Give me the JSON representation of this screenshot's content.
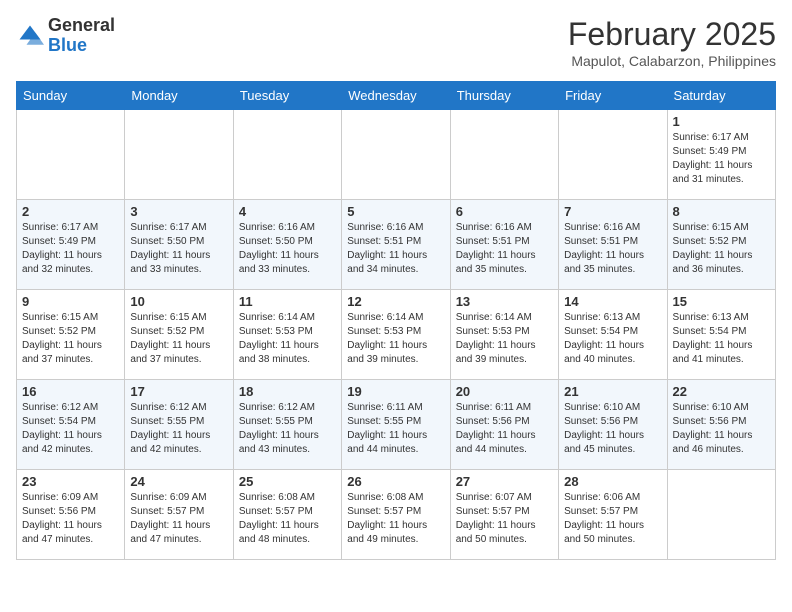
{
  "header": {
    "logo_general": "General",
    "logo_blue": "Blue",
    "month_year": "February 2025",
    "location": "Mapulot, Calabarzon, Philippines"
  },
  "weekdays": [
    "Sunday",
    "Monday",
    "Tuesday",
    "Wednesday",
    "Thursday",
    "Friday",
    "Saturday"
  ],
  "weeks": [
    [
      {
        "day": "",
        "info": ""
      },
      {
        "day": "",
        "info": ""
      },
      {
        "day": "",
        "info": ""
      },
      {
        "day": "",
        "info": ""
      },
      {
        "day": "",
        "info": ""
      },
      {
        "day": "",
        "info": ""
      },
      {
        "day": "1",
        "info": "Sunrise: 6:17 AM\nSunset: 5:49 PM\nDaylight: 11 hours\nand 31 minutes."
      }
    ],
    [
      {
        "day": "2",
        "info": "Sunrise: 6:17 AM\nSunset: 5:49 PM\nDaylight: 11 hours\nand 32 minutes."
      },
      {
        "day": "3",
        "info": "Sunrise: 6:17 AM\nSunset: 5:50 PM\nDaylight: 11 hours\nand 33 minutes."
      },
      {
        "day": "4",
        "info": "Sunrise: 6:16 AM\nSunset: 5:50 PM\nDaylight: 11 hours\nand 33 minutes."
      },
      {
        "day": "5",
        "info": "Sunrise: 6:16 AM\nSunset: 5:51 PM\nDaylight: 11 hours\nand 34 minutes."
      },
      {
        "day": "6",
        "info": "Sunrise: 6:16 AM\nSunset: 5:51 PM\nDaylight: 11 hours\nand 35 minutes."
      },
      {
        "day": "7",
        "info": "Sunrise: 6:16 AM\nSunset: 5:51 PM\nDaylight: 11 hours\nand 35 minutes."
      },
      {
        "day": "8",
        "info": "Sunrise: 6:15 AM\nSunset: 5:52 PM\nDaylight: 11 hours\nand 36 minutes."
      }
    ],
    [
      {
        "day": "9",
        "info": "Sunrise: 6:15 AM\nSunset: 5:52 PM\nDaylight: 11 hours\nand 37 minutes."
      },
      {
        "day": "10",
        "info": "Sunrise: 6:15 AM\nSunset: 5:52 PM\nDaylight: 11 hours\nand 37 minutes."
      },
      {
        "day": "11",
        "info": "Sunrise: 6:14 AM\nSunset: 5:53 PM\nDaylight: 11 hours\nand 38 minutes."
      },
      {
        "day": "12",
        "info": "Sunrise: 6:14 AM\nSunset: 5:53 PM\nDaylight: 11 hours\nand 39 minutes."
      },
      {
        "day": "13",
        "info": "Sunrise: 6:14 AM\nSunset: 5:53 PM\nDaylight: 11 hours\nand 39 minutes."
      },
      {
        "day": "14",
        "info": "Sunrise: 6:13 AM\nSunset: 5:54 PM\nDaylight: 11 hours\nand 40 minutes."
      },
      {
        "day": "15",
        "info": "Sunrise: 6:13 AM\nSunset: 5:54 PM\nDaylight: 11 hours\nand 41 minutes."
      }
    ],
    [
      {
        "day": "16",
        "info": "Sunrise: 6:12 AM\nSunset: 5:54 PM\nDaylight: 11 hours\nand 42 minutes."
      },
      {
        "day": "17",
        "info": "Sunrise: 6:12 AM\nSunset: 5:55 PM\nDaylight: 11 hours\nand 42 minutes."
      },
      {
        "day": "18",
        "info": "Sunrise: 6:12 AM\nSunset: 5:55 PM\nDaylight: 11 hours\nand 43 minutes."
      },
      {
        "day": "19",
        "info": "Sunrise: 6:11 AM\nSunset: 5:55 PM\nDaylight: 11 hours\nand 44 minutes."
      },
      {
        "day": "20",
        "info": "Sunrise: 6:11 AM\nSunset: 5:56 PM\nDaylight: 11 hours\nand 44 minutes."
      },
      {
        "day": "21",
        "info": "Sunrise: 6:10 AM\nSunset: 5:56 PM\nDaylight: 11 hours\nand 45 minutes."
      },
      {
        "day": "22",
        "info": "Sunrise: 6:10 AM\nSunset: 5:56 PM\nDaylight: 11 hours\nand 46 minutes."
      }
    ],
    [
      {
        "day": "23",
        "info": "Sunrise: 6:09 AM\nSunset: 5:56 PM\nDaylight: 11 hours\nand 47 minutes."
      },
      {
        "day": "24",
        "info": "Sunrise: 6:09 AM\nSunset: 5:57 PM\nDaylight: 11 hours\nand 47 minutes."
      },
      {
        "day": "25",
        "info": "Sunrise: 6:08 AM\nSunset: 5:57 PM\nDaylight: 11 hours\nand 48 minutes."
      },
      {
        "day": "26",
        "info": "Sunrise: 6:08 AM\nSunset: 5:57 PM\nDaylight: 11 hours\nand 49 minutes."
      },
      {
        "day": "27",
        "info": "Sunrise: 6:07 AM\nSunset: 5:57 PM\nDaylight: 11 hours\nand 50 minutes."
      },
      {
        "day": "28",
        "info": "Sunrise: 6:06 AM\nSunset: 5:57 PM\nDaylight: 11 hours\nand 50 minutes."
      },
      {
        "day": "",
        "info": ""
      }
    ]
  ]
}
